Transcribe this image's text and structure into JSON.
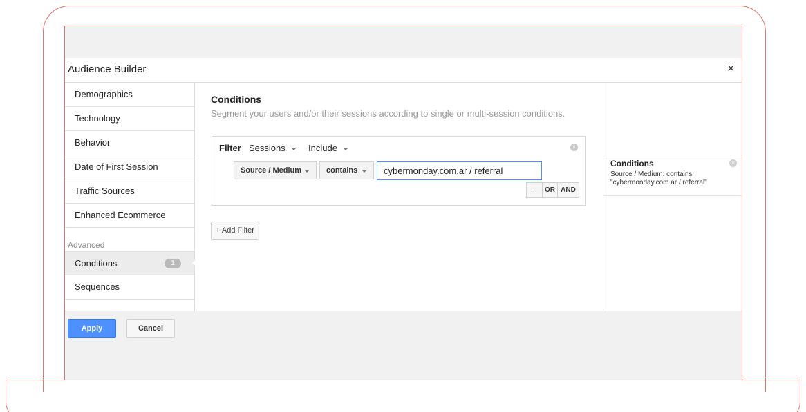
{
  "colors": {
    "frame": "#e0736b",
    "accent": "#4d90fe",
    "input_border": "#4d90fe"
  },
  "dialog": {
    "title": "Audience Builder",
    "close_label": "×"
  },
  "sidebar": {
    "items": [
      {
        "label": "Demographics"
      },
      {
        "label": "Technology"
      },
      {
        "label": "Behavior"
      },
      {
        "label": "Date of First Session"
      },
      {
        "label": "Traffic Sources"
      },
      {
        "label": "Enhanced Ecommerce"
      }
    ],
    "section_label": "Advanced",
    "advanced_items": [
      {
        "label": "Conditions",
        "badge": "1",
        "active": true
      },
      {
        "label": "Sequences"
      }
    ]
  },
  "main": {
    "title": "Conditions",
    "subtitle": "Segment your users and/or their sessions according to single or multi-session conditions.",
    "filter": {
      "label": "Filter",
      "scope": "Sessions",
      "mode": "Include",
      "dimension": "Source / Medium",
      "operator": "contains",
      "value": "cybermonday.com.ar / referral",
      "minus_label": "–",
      "or_label": "OR",
      "and_label": "AND",
      "remove_label": "×"
    },
    "add_filter_label": "+ Add Filter"
  },
  "summary": {
    "title": "Conditions",
    "text": "Source / Medium: contains \"cybermonday.com.ar / referral\"",
    "remove_label": "×"
  },
  "footer": {
    "apply_label": "Apply",
    "cancel_label": "Cancel"
  }
}
